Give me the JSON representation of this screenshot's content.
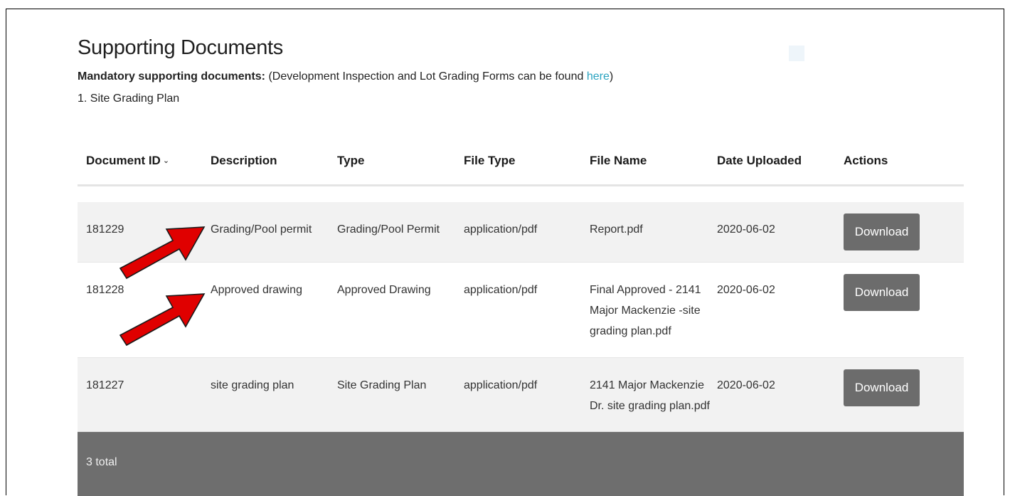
{
  "page": {
    "title": "Supporting Documents",
    "mandatory_label": "Mandatory supporting documents:",
    "mandatory_text_before": " (Development Inspection and Lot Grading Forms can be found ",
    "mandatory_link": "here",
    "mandatory_text_after": ")",
    "required_item": "1. Site Grading Plan"
  },
  "table": {
    "columns": [
      "Document ID",
      "Description",
      "Type",
      "File Type",
      "File Name",
      "Date Uploaded",
      "Actions"
    ],
    "sort_icon": "chevron-down-icon",
    "rows": [
      {
        "id": "181229",
        "description": "Grading/Pool permit",
        "type": "Grading/Pool Permit",
        "file_type": "application/pdf",
        "file_name": [
          "Report.pdf"
        ],
        "date": "2020-06-02",
        "action": "Download"
      },
      {
        "id": "181228",
        "description": "Approved drawing",
        "type": "Approved Drawing",
        "file_type": "application/pdf",
        "file_name": [
          "Final Approved - 2141",
          "Major Mackenzie -site",
          "grading plan.pdf"
        ],
        "date": "2020-06-02",
        "action": "Download"
      },
      {
        "id": "181227",
        "description": "site grading plan",
        "type": "Site Grading Plan",
        "file_type": "application/pdf",
        "file_name": [
          "2141 Major Mackenzie",
          "Dr. site grading plan.pdf"
        ],
        "date": "2020-06-02",
        "action": "Download"
      }
    ],
    "footer_total": "3 total"
  },
  "colors": {
    "link": "#2aa3c0",
    "button": "#6c6c6c",
    "footer": "#6e6e6e",
    "arrow": "#e00000"
  }
}
